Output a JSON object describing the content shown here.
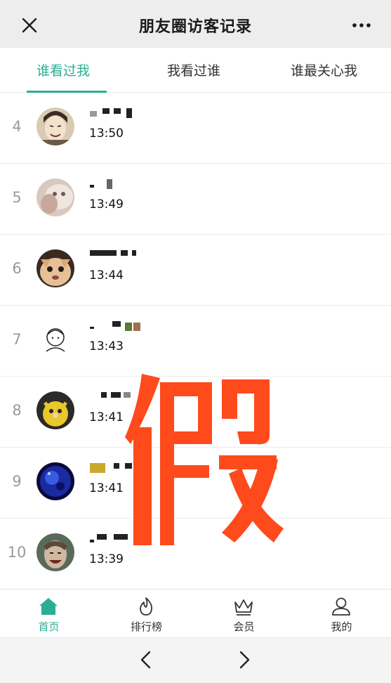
{
  "header": {
    "title": "朋友圈访客记录",
    "close_icon": "close-icon",
    "more_icon": "more-icon"
  },
  "tabs": [
    {
      "label": "谁看过我",
      "active": true
    },
    {
      "label": "我看过谁",
      "active": false
    },
    {
      "label": "谁最关心我",
      "active": false
    }
  ],
  "accent_color": "#2bae93",
  "visitors": [
    {
      "rank": "4",
      "time": "13:50"
    },
    {
      "rank": "5",
      "time": "13:49"
    },
    {
      "rank": "6",
      "time": "13:44"
    },
    {
      "rank": "7",
      "time": "13:43"
    },
    {
      "rank": "8",
      "time": "13:41"
    },
    {
      "rank": "9",
      "time": "13:41"
    },
    {
      "rank": "10",
      "time": "13:39"
    }
  ],
  "watermark": {
    "text": "假",
    "color": "#ff4a1c"
  },
  "bottom_nav": [
    {
      "label": "首页",
      "icon": "home-icon",
      "active": true
    },
    {
      "label": "排行榜",
      "icon": "flame-icon",
      "active": false
    },
    {
      "label": "会员",
      "icon": "crown-icon",
      "active": false
    },
    {
      "label": "我的",
      "icon": "user-icon",
      "active": false
    }
  ]
}
